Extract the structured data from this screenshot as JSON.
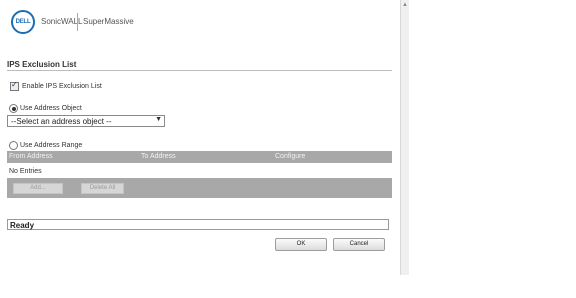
{
  "header": {
    "logo_text": "DELL",
    "brand": "SonicWALL",
    "product": "SuperMassive"
  },
  "section": {
    "title": "IPS Exclusion List"
  },
  "enable": {
    "label": "Enable IPS Exclusion List",
    "checked": true
  },
  "mode": {
    "address_object_label": "Use Address Object",
    "address_object_selected": true,
    "address_range_label": "Use Address Range",
    "address_range_selected": false
  },
  "address_object_select": {
    "value": "--Select an address object --"
  },
  "range_table": {
    "columns": [
      "From Address",
      "To Address",
      "Configure"
    ],
    "empty_text": "No Entries",
    "add_label": "Add...",
    "delete_all_label": "Delete All"
  },
  "status": {
    "text": "Ready"
  },
  "dialog": {
    "ok_label": "OK",
    "cancel_label": "Cancel"
  }
}
